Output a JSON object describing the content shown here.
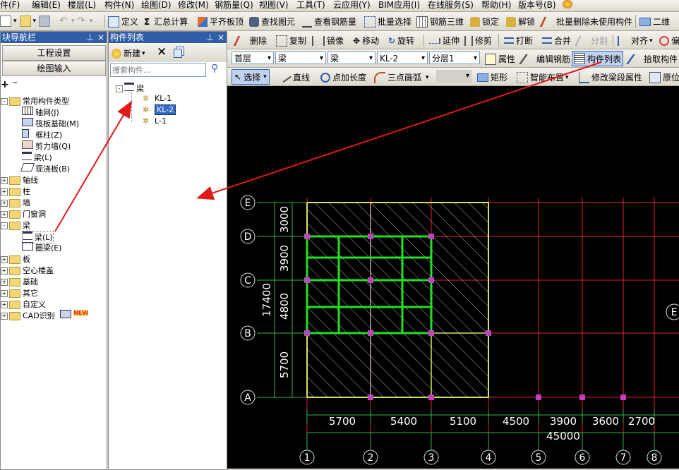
{
  "menu": [
    "件(F)",
    "编辑(E)",
    "楼层(L)",
    "构件(N)",
    "绘图(D)",
    "修改(M)",
    "钢筋量(Q)",
    "视图(V)",
    "工具(T)",
    "云应用(Y)",
    "BIM应用(I)",
    "在线服务(S)",
    "帮助(H)",
    "版本号(B)"
  ],
  "toolbar1": {
    "define": "定义",
    "summary": "汇总计算",
    "flush_slab": "平齐板顶",
    "find_elem": "查找图元",
    "view_rebar": "查看钢筋量",
    "batch_select": "批量选择",
    "rebar_3d": "钢筋三维",
    "lock": "锁定",
    "unlock": "解锁",
    "batch_delete": "批量删除未使用构件",
    "view_mode": "二维"
  },
  "toolbar2": {
    "delete": "删除",
    "copy": "复制",
    "mirror": "镜像",
    "move": "移动",
    "rotate": "旋转",
    "extend": "延伸",
    "trim": "修剪",
    "break": "打断",
    "merge": "合并",
    "split": "分割",
    "align": "对齐",
    "offset": "偏"
  },
  "toolbar3": {
    "floor": "首层",
    "type1": "梁",
    "type2": "梁",
    "member": "KL-2",
    "layer": "分层1",
    "props": "属性",
    "edit_rebar": "编辑钢筋",
    "member_list": "构件列表",
    "pick": "拾取构件"
  },
  "toolbar4": {
    "select": "选择",
    "line": "直线",
    "point_length": "点加长度",
    "arc3": "三点画弧",
    "rect": "矩形",
    "smart": "智能布置",
    "modify_seg": "修改梁段属性",
    "origin": "原位"
  },
  "nav": {
    "title": "块导航栏",
    "pin": "ᵠ",
    "close": "×",
    "btn_settings": "工程设置",
    "btn_draw": "绘图输入",
    "tree_root": "常用构件类型",
    "common_items": [
      "轴网(J)",
      "筏板基础(M)",
      "框柱(Z)",
      "剪力墙(Q)",
      "梁(L)",
      "现浇板(B)"
    ],
    "groups_a": [
      "轴线",
      "柱",
      "墙",
      "门窗洞"
    ],
    "beam_group": "梁",
    "beam_items": [
      "梁(L)",
      "圈梁(E)"
    ],
    "groups_b": [
      "板",
      "空心楼盖",
      "基础",
      "其它",
      "自定义",
      "CAD识别"
    ],
    "new_badge": "NEW"
  },
  "member_panel": {
    "title": "构件列表",
    "new": "新建",
    "search_placeholder": "搜索构件...",
    "root": "梁",
    "items": [
      "KL-1",
      "KL-2",
      "L-1"
    ],
    "selected": "KL-2"
  },
  "canvas": {
    "row_labels": [
      "E",
      "D",
      "C",
      "B",
      "A"
    ],
    "row_dims": [
      "3000",
      "3900",
      "4800",
      "5700"
    ],
    "total_y": "17400",
    "col_labels": [
      "1",
      "2",
      "3",
      "4",
      "5",
      "6",
      "7",
      "8"
    ],
    "col_dims": [
      "5700",
      "5400",
      "5100",
      "4500",
      "3900",
      "3600",
      "2700"
    ],
    "total_x": "45000",
    "right_label": "E"
  },
  "colors": {
    "canvas_bg": "#000000",
    "grid_red": "#e0203a",
    "beam_green": "#22e022",
    "slab_yellow": "#d8e060",
    "dim_green": "#2fb84a",
    "node_magenta": "#c040c0",
    "arrow_red": "#e01818",
    "title_blue": "#2f5da8"
  }
}
